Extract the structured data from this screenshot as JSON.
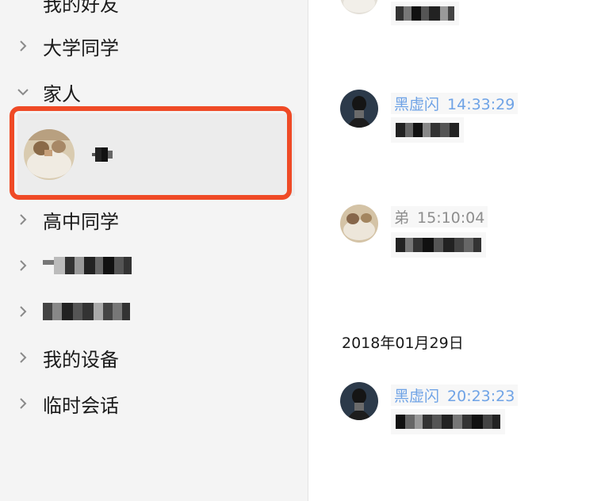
{
  "sidebar": {
    "groups": [
      {
        "label": "我的好友"
      },
      {
        "label": "大学同学"
      },
      {
        "label": "家人"
      },
      {
        "label": "高中同学"
      },
      {
        "label": ""
      },
      {
        "label": ""
      },
      {
        "label": "我的设备"
      },
      {
        "label": "临时会话"
      }
    ],
    "selected_contact": {
      "name": ""
    }
  },
  "chat": {
    "messages": [
      {
        "sender": "黑虚闪",
        "time": "14:33:29"
      },
      {
        "sender": "弟",
        "time": "15:10:04"
      },
      {
        "sender": "黑虚闪",
        "time": "20:23:23"
      }
    ],
    "date_separator": "2018年01月29日"
  },
  "colors": {
    "highlight": "#ef4a26",
    "sender_link": "#6fa3e6"
  }
}
